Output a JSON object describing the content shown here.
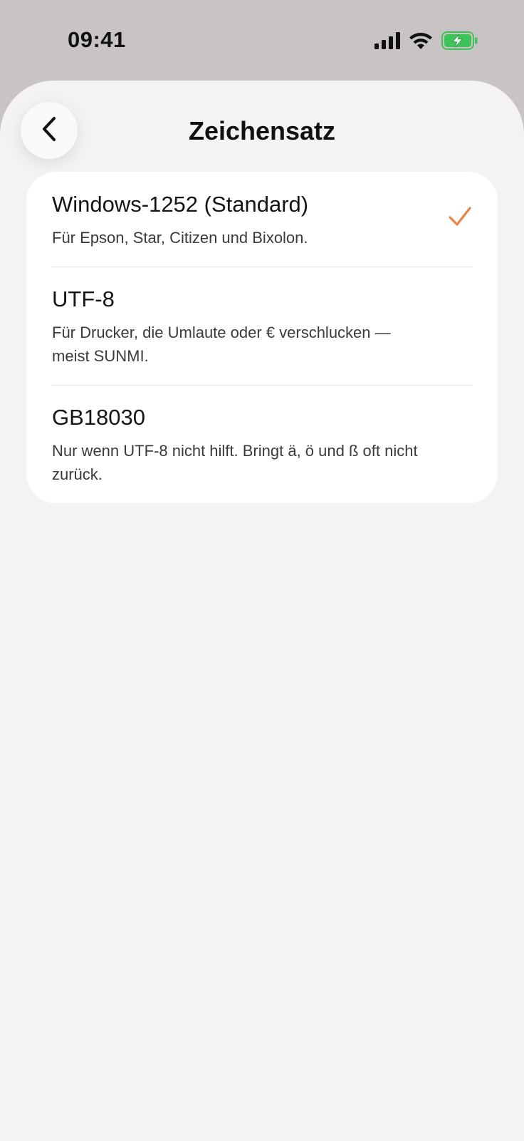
{
  "status_bar": {
    "time": "09:41",
    "icons": [
      "cellular-signal-icon",
      "wifi-icon",
      "battery-charging-icon"
    ]
  },
  "header": {
    "title": "Zeichensatz",
    "back_icon": "chevron-left-icon"
  },
  "options": [
    {
      "title": "Windows-1252 (Standard)",
      "description": "Für Epson, Star, Citizen und Bixolon.",
      "selected": true
    },
    {
      "title": "UTF-8",
      "description": "Für Drucker, die Umlaute oder € verschlucken — meist SUNMI.",
      "selected": false
    },
    {
      "title": "GB18030",
      "description": "Nur wenn UTF-8 nicht hilft. Bringt ä, ö und ß oft nicht zurück.",
      "selected": false
    }
  ],
  "colors": {
    "accent": "#e8834a",
    "battery": "#3ec35a",
    "sheet_background": "#f4f3f1",
    "backdrop": "#c8c4c3"
  }
}
